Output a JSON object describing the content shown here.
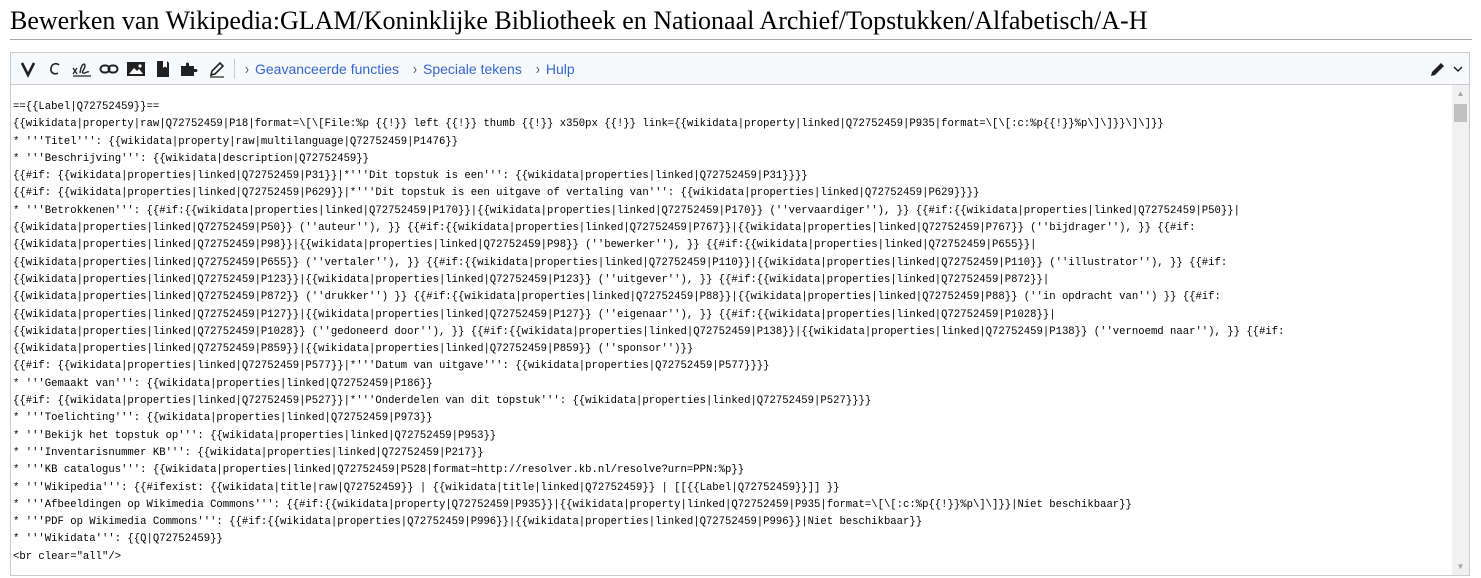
{
  "page": {
    "title": "Bewerken van Wikipedia:GLAM/Koninklijke Bibliotheek en Nationaal Archief/Topstukken/Alfabetisch/A-H"
  },
  "toolbar": {
    "buttons": [
      {
        "icon": "bold-icon"
      },
      {
        "icon": "italic-icon"
      },
      {
        "icon": "signature-icon"
      },
      {
        "icon": "link-icon"
      },
      {
        "icon": "image-icon"
      },
      {
        "icon": "reference-icon"
      },
      {
        "icon": "puzzle-icon"
      },
      {
        "icon": "pencil-icon"
      }
    ],
    "links": {
      "advanced": "Geavanceerde functies",
      "special": "Speciale tekens",
      "help": "Hulp"
    },
    "edit_mode_icon": "pencil-icon",
    "accent_color": "#3366cc"
  },
  "editor": {
    "lines": [
      "=={{Label|Q72752459}}==",
      "{{wikidata|property|raw|Q72752459|P18|format=\\[\\[File:%p {{!}} left {{!}} thumb {{!}} x350px {{!}} link={{wikidata|property|linked|Q72752459|P935|format=\\[\\[:c:%p{{!}}%p\\]\\]}}\\]\\]}}",
      "* '''Titel''': {{wikidata|property|raw|multilanguage|Q72752459|P1476}}",
      "* '''Beschrijving''': {{wikidata|description|Q72752459}}",
      "{{#if: {{wikidata|properties|linked|Q72752459|P31}}|*'''Dit topstuk is een''': {{wikidata|properties|linked|Q72752459|P31}}}}",
      "{{#if: {{wikidata|properties|linked|Q72752459|P629}}|*'''Dit topstuk is een uitgave of vertaling van''': {{wikidata|properties|linked|Q72752459|P629}}}}",
      "* '''Betrokkenen''': {{#if:{{wikidata|properties|linked|Q72752459|P170}}|{{wikidata|properties|linked|Q72752459|P170}} (''vervaardiger''), }} {{#if:{{wikidata|properties|linked|Q72752459|P50}}|",
      "{{wikidata|properties|linked|Q72752459|P50}} (''auteur''), }} {{#if:{{wikidata|properties|linked|Q72752459|P767}}|{{wikidata|properties|linked|Q72752459|P767}} (''bijdrager''), }} {{#if:",
      "{{wikidata|properties|linked|Q72752459|P98}}|{{wikidata|properties|linked|Q72752459|P98}} (''bewerker''), }} {{#if:{{wikidata|properties|linked|Q72752459|P655}}|",
      "{{wikidata|properties|linked|Q72752459|P655}} (''vertaler''), }} {{#if:{{wikidata|properties|linked|Q72752459|P110}}|{{wikidata|properties|linked|Q72752459|P110}} (''illustrator''), }} {{#if:",
      "{{wikidata|properties|linked|Q72752459|P123}}|{{wikidata|properties|linked|Q72752459|P123}} (''uitgever''), }} {{#if:{{wikidata|properties|linked|Q72752459|P872}}|",
      "{{wikidata|properties|linked|Q72752459|P872}} (''drukker'') }} {{#if:{{wikidata|properties|linked|Q72752459|P88}}|{{wikidata|properties|linked|Q72752459|P88}} (''in opdracht van'') }} {{#if:",
      "{{wikidata|properties|linked|Q72752459|P127}}|{{wikidata|properties|linked|Q72752459|P127}} (''eigenaar''), }} {{#if:{{wikidata|properties|linked|Q72752459|P1028}}|",
      "{{wikidata|properties|linked|Q72752459|P1028}} (''gedoneerd door''), }} {{#if:{{wikidata|properties|linked|Q72752459|P138}}|{{wikidata|properties|linked|Q72752459|P138}} (''vernoemd naar''), }} {{#if:",
      "{{wikidata|properties|linked|Q72752459|P859}}|{{wikidata|properties|linked|Q72752459|P859}} (''sponsor'')}}",
      "{{#if: {{wikidata|properties|linked|Q72752459|P577}}|*'''Datum van uitgave''': {{wikidata|properties|Q72752459|P577}}}}",
      "* '''Gemaakt van''': {{wikidata|properties|linked|Q72752459|P186}}",
      "{{#if: {{wikidata|properties|linked|Q72752459|P527}}|*'''Onderdelen van dit topstuk''': {{wikidata|properties|linked|Q72752459|P527}}}}",
      "* '''Toelichting''': {{wikidata|properties|linked|Q72752459|P973}}",
      "* '''Bekijk het topstuk op''': {{wikidata|properties|linked|Q72752459|P953}}",
      "* '''Inventarisnummer KB''': {{wikidata|properties|linked|Q72752459|P217}}",
      "* '''KB catalogus''': {{wikidata|properties|linked|Q72752459|P528|format=http://resolver.kb.nl/resolve?urn=PPN:%p}}",
      "* '''Wikipedia''': {{#ifexist: {{wikidata|title|raw|Q72752459}} | {{wikidata|title|linked|Q72752459}} | [[{{Label|Q72752459}}]] }}",
      "* '''Afbeeldingen op Wikimedia Commons''': {{#if:{{wikidata|property|Q72752459|P935}}|{{wikidata|property|linked|Q72752459|P935|format=\\[\\[:c:%p{{!}}%p\\]\\]}}|Niet beschikbaar}}",
      "* '''PDF op Wikimedia Commons''': {{#if:{{wikidata|properties|Q72752459|P996}}|{{wikidata|properties|linked|Q72752459|P996}}|Niet beschikbaar}}",
      "* '''Wikidata''': {{Q|Q72752459}}",
      "<br clear=\"all\"/>"
    ]
  }
}
